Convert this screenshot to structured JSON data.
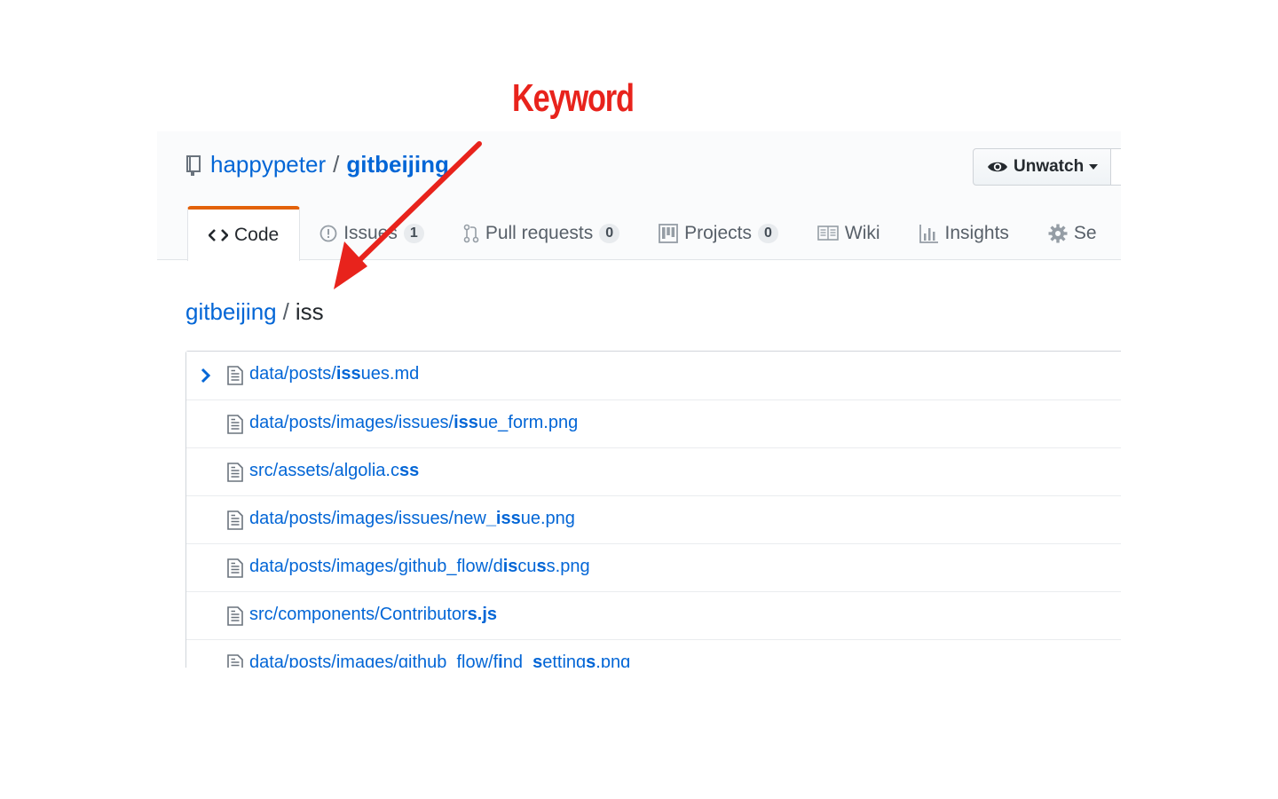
{
  "annotation": {
    "label": "Keyword",
    "color": "#e8231c"
  },
  "repo": {
    "owner": "happypeter",
    "separator": "/",
    "name": "gitbeijing"
  },
  "watch_button": {
    "label": "Unwatch"
  },
  "tabs": [
    {
      "label": "Code",
      "icon": "code-icon",
      "active": true,
      "counter": ""
    },
    {
      "label": "Issues",
      "icon": "issue-icon",
      "active": false,
      "counter": "1"
    },
    {
      "label": "Pull requests",
      "icon": "pull-request-icon",
      "active": false,
      "counter": "0"
    },
    {
      "label": "Projects",
      "icon": "project-icon",
      "active": false,
      "counter": "0"
    },
    {
      "label": "Wiki",
      "icon": "book-icon",
      "active": false,
      "counter": ""
    },
    {
      "label": "Insights",
      "icon": "graph-icon",
      "active": false,
      "counter": ""
    },
    {
      "label": "Se",
      "icon": "gear-icon",
      "active": false,
      "counter": ""
    }
  ],
  "breadcrumb": {
    "root": "gitbeijing",
    "separator": "/",
    "query": "iss"
  },
  "files": [
    {
      "segments": [
        [
          "data/posts/",
          false
        ],
        [
          "iss",
          true
        ],
        [
          "ues.md",
          false
        ]
      ],
      "selected": true
    },
    {
      "segments": [
        [
          "data/posts/images/issues/",
          false
        ],
        [
          "iss",
          true
        ],
        [
          "ue_form.png",
          false
        ]
      ],
      "selected": false
    },
    {
      "segments": [
        [
          "src/assets/algolia.c",
          false
        ],
        [
          "ss",
          true
        ]
      ],
      "selected": false
    },
    {
      "segments": [
        [
          "data/posts/images/issues/new",
          false
        ],
        [
          "_iss",
          true
        ],
        [
          "ue.png",
          false
        ]
      ],
      "selected": false
    },
    {
      "segments": [
        [
          "data/posts/images/github_flow/d",
          false
        ],
        [
          "is",
          true
        ],
        [
          "cu",
          false
        ],
        [
          "s",
          true
        ],
        [
          "s.png",
          false
        ]
      ],
      "selected": false
    },
    {
      "segments": [
        [
          "src/components/Contributor",
          false
        ],
        [
          "s.js",
          true
        ]
      ],
      "selected": false
    },
    {
      "segments": [
        [
          "data/posts/images/github_flow/f",
          false
        ],
        [
          "i",
          true
        ],
        [
          "nd_",
          false
        ],
        [
          "s",
          true
        ],
        [
          "etting",
          false
        ],
        [
          "s",
          true
        ],
        [
          ".png",
          false
        ]
      ],
      "selected": false
    }
  ],
  "colors": {
    "link": "#0366d6",
    "active_tab_border": "#e36209",
    "arrow": "#e8231c"
  }
}
